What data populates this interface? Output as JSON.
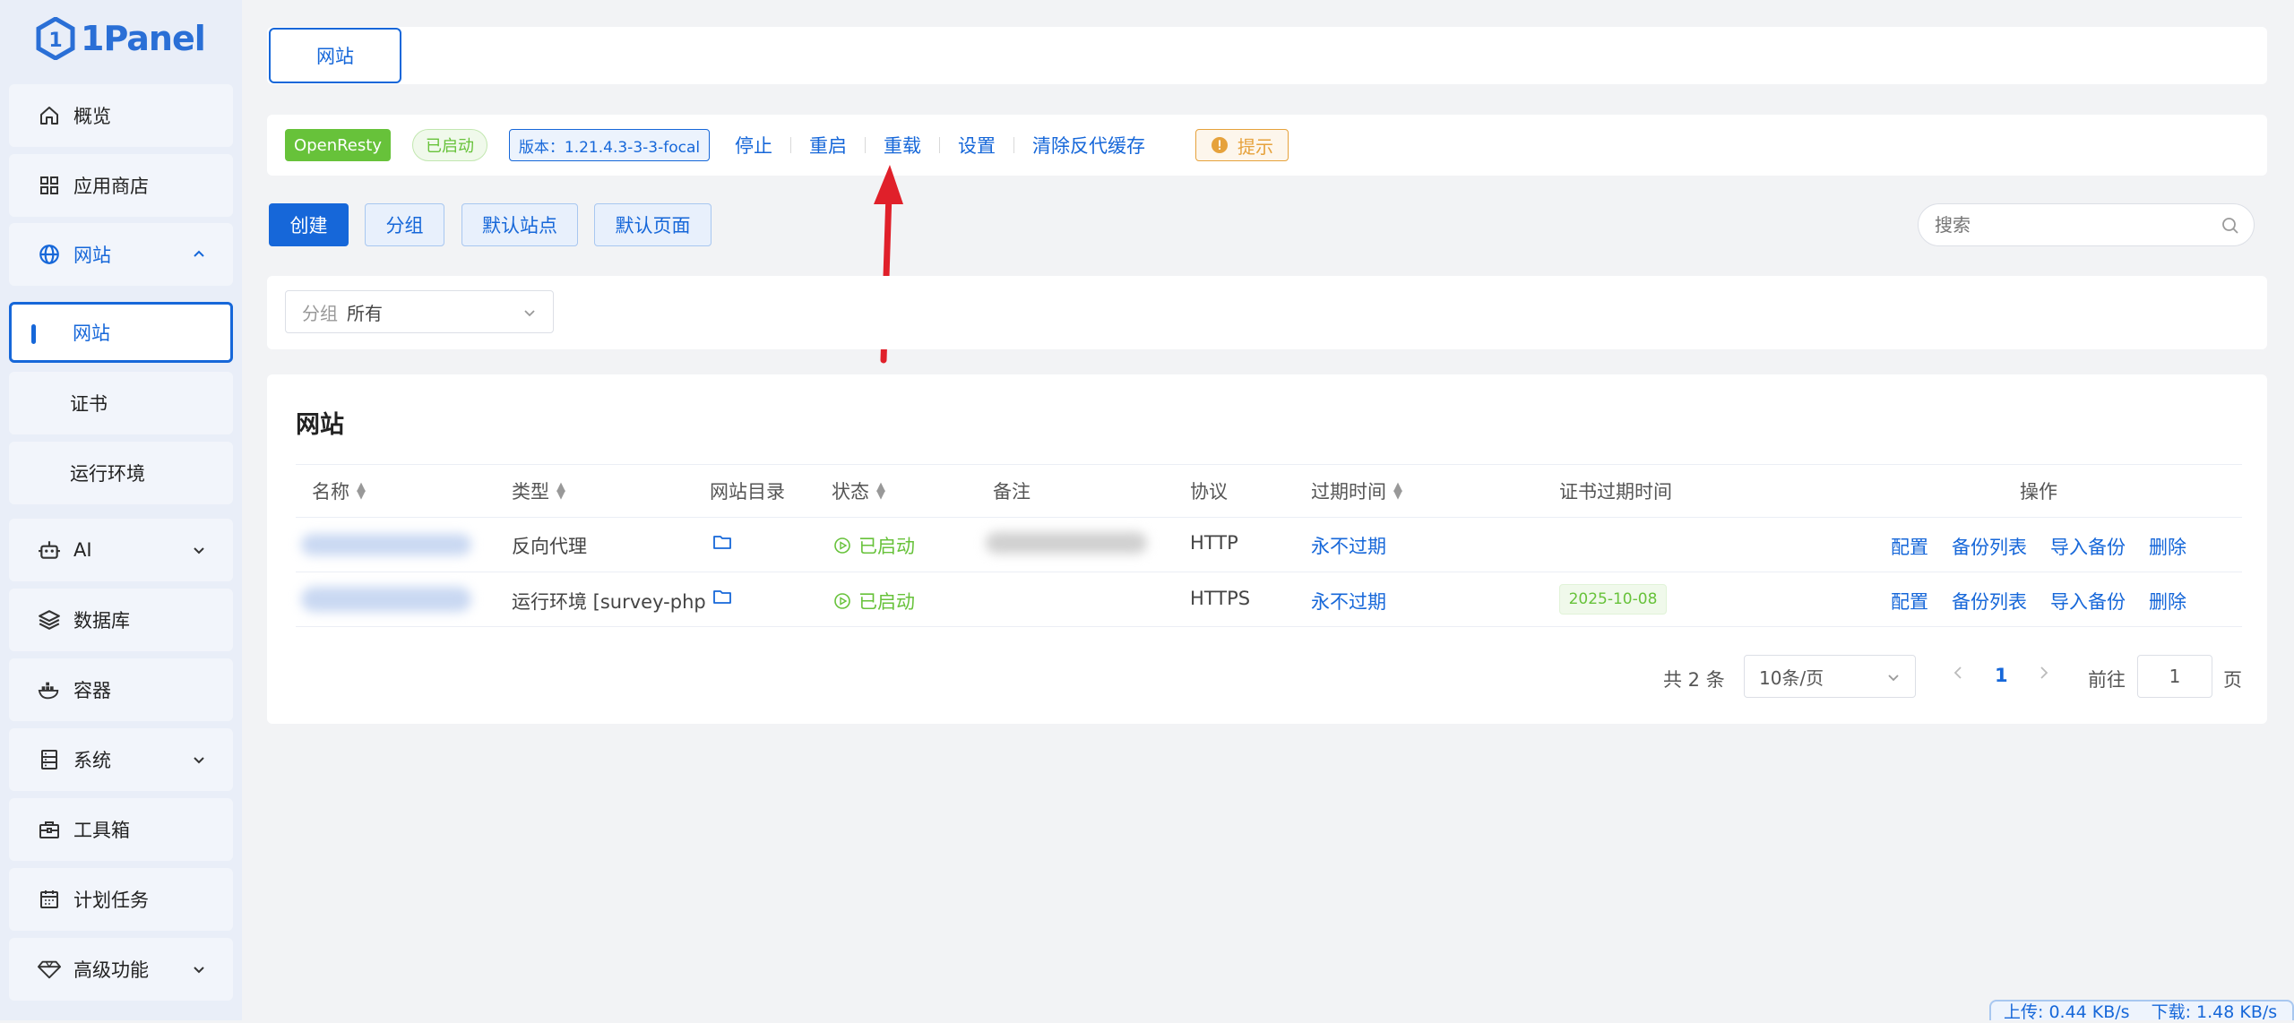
{
  "app": {
    "logo_text": "1Panel"
  },
  "sidebar": {
    "items": [
      {
        "label": "概览",
        "icon": "home-icon"
      },
      {
        "label": "应用商店",
        "icon": "grid-icon"
      },
      {
        "label": "网站",
        "icon": "globe-icon",
        "expanded": true
      },
      {
        "label": "网站",
        "sub": true,
        "active": true
      },
      {
        "label": "证书",
        "sub": true
      },
      {
        "label": "运行环境",
        "sub": true
      },
      {
        "label": "AI",
        "icon": "robot-icon"
      },
      {
        "label": "数据库",
        "icon": "layers-icon"
      },
      {
        "label": "容器",
        "icon": "docker-icon"
      },
      {
        "label": "系统",
        "icon": "server-icon"
      },
      {
        "label": "工具箱",
        "icon": "toolbox-icon"
      },
      {
        "label": "计划任务",
        "icon": "calendar-icon"
      },
      {
        "label": "高级功能",
        "icon": "diamond-icon"
      }
    ]
  },
  "tabs": {
    "website": "网站"
  },
  "status_bar": {
    "app_name": "OpenResty",
    "state": "已启动",
    "version": "版本：1.21.4.3-3-3-focal",
    "actions": [
      "停止",
      "重启",
      "重载",
      "设置",
      "清除反代缓存"
    ],
    "tip": "提示"
  },
  "toolbar": {
    "create": "创建",
    "group": "分组",
    "default_site": "默认站点",
    "default_page": "默认页面",
    "search_placeholder": "搜索"
  },
  "filter": {
    "label": "分组",
    "value": "所有"
  },
  "table": {
    "title": "网站",
    "columns": [
      "名称",
      "类型",
      "网站目录",
      "状态",
      "备注",
      "协议",
      "过期时间",
      "证书过期时间",
      "操作"
    ],
    "rows": [
      {
        "type": "反向代理",
        "status": "已启动",
        "protocol": "HTTP",
        "expire": "永不过期",
        "cert_expire": "",
        "ops": [
          "配置",
          "备份列表",
          "导入备份",
          "删除"
        ]
      },
      {
        "type": "运行环境 [survey-php",
        "status": "已启动",
        "protocol": "HTTPS",
        "expire": "永不过期",
        "cert_expire": "2025-10-08",
        "ops": [
          "配置",
          "备份列表",
          "导入备份",
          "删除"
        ]
      }
    ]
  },
  "pagination": {
    "total": "共 2 条",
    "page_size": "10条/页",
    "current": "1",
    "goto_label": "前往",
    "goto_value": "1",
    "page_suffix": "页"
  },
  "footer": {
    "upload": "上传: 0.44 KB/s",
    "download": "下载: 1.48 KB/s"
  },
  "colors": {
    "primary": "#1667d9",
    "success": "#67c23a",
    "warning": "#e6a23c"
  }
}
